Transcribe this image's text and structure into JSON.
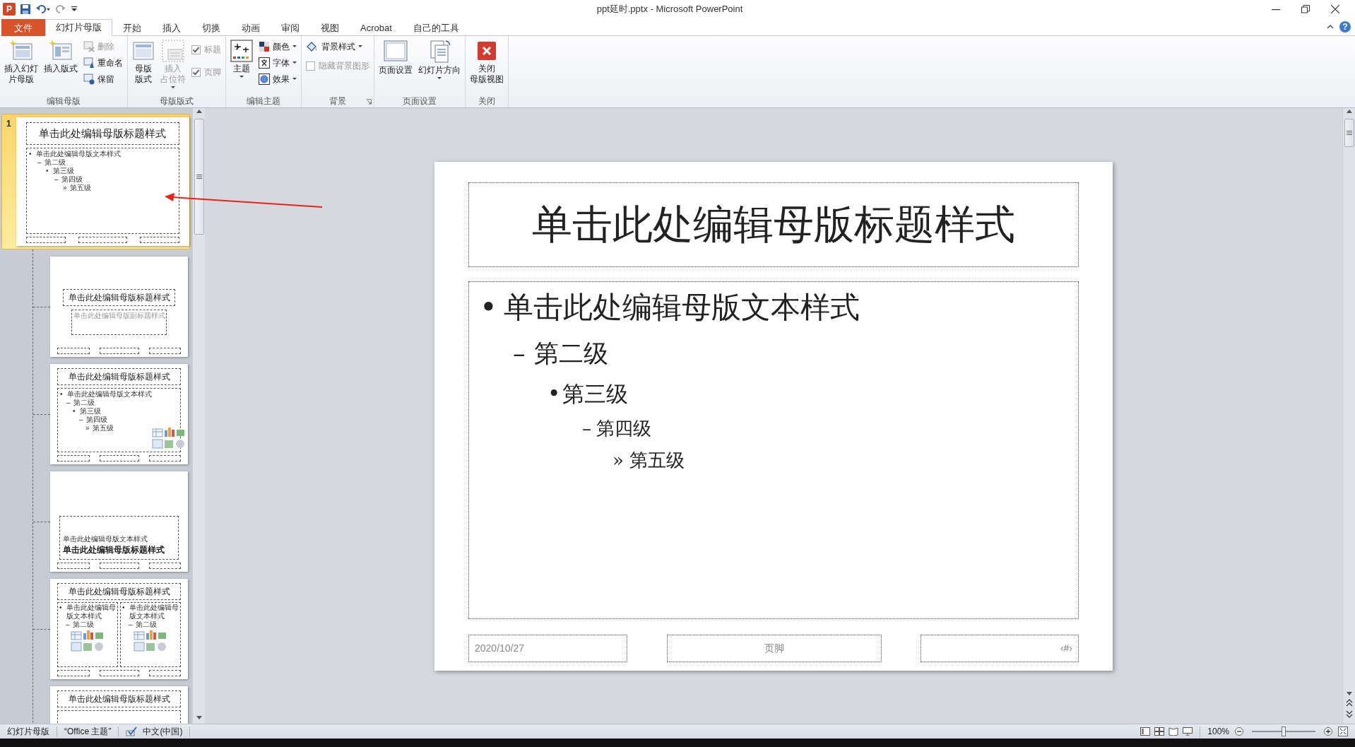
{
  "app": {
    "logo": "P",
    "title": "ppt延时.pptx  -  Microsoft PowerPoint",
    "help": "?"
  },
  "tabs": [
    {
      "label": "文件",
      "kind": "file",
      "selected": false
    },
    {
      "label": "幻灯片母版",
      "kind": "tab",
      "selected": true
    },
    {
      "label": "开始",
      "kind": "tab",
      "selected": false
    },
    {
      "label": "插入",
      "kind": "tab",
      "selected": false
    },
    {
      "label": "切换",
      "kind": "tab",
      "selected": false
    },
    {
      "label": "动画",
      "kind": "tab",
      "selected": false
    },
    {
      "label": "审阅",
      "kind": "tab",
      "selected": false
    },
    {
      "label": "视图",
      "kind": "tab",
      "selected": false
    },
    {
      "label": "Acrobat",
      "kind": "tab",
      "selected": false
    },
    {
      "label": "自己的工具",
      "kind": "tab",
      "selected": false
    }
  ],
  "ribbon": {
    "groups": [
      {
        "label": "编辑母版",
        "launcher": false,
        "controls": [
          {
            "kind": "large",
            "lines": [
              "插入幻灯",
              "片母版"
            ],
            "disabled": false,
            "dropdown": false
          },
          {
            "kind": "large",
            "lines": [
              "插入版式"
            ],
            "disabled": false,
            "dropdown": false
          },
          {
            "kind": "stack",
            "items": [
              {
                "kind": "small",
                "label": "删除",
                "disabled": true,
                "dropdown": false
              },
              {
                "kind": "small",
                "label": "重命名",
                "disabled": false,
                "dropdown": false
              },
              {
                "kind": "small",
                "label": "保留",
                "disabled": false,
                "dropdown": false
              }
            ]
          }
        ]
      },
      {
        "label": "母版版式",
        "launcher": false,
        "controls": [
          {
            "kind": "large",
            "lines": [
              "母版",
              "版式"
            ],
            "disabled": false,
            "dropdown": false
          },
          {
            "kind": "large",
            "lines": [
              "插入",
              "占位符"
            ],
            "disabled": true,
            "dropdown": true
          },
          {
            "kind": "stack",
            "items": [
              {
                "kind": "check",
                "label": "标题",
                "checked": true,
                "disabled": true
              },
              {
                "kind": "check",
                "label": "页脚",
                "checked": true,
                "disabled": true
              }
            ]
          }
        ]
      },
      {
        "label": "编辑主题",
        "launcher": false,
        "controls": [
          {
            "kind": "large",
            "lines": [
              "主题"
            ],
            "disabled": false,
            "dropdown": true
          },
          {
            "kind": "stack",
            "items": [
              {
                "kind": "small",
                "label": "颜色",
                "disabled": false,
                "dropdown": true
              },
              {
                "kind": "small",
                "label": "字体",
                "disabled": false,
                "dropdown": true
              },
              {
                "kind": "small",
                "label": "效果",
                "disabled": false,
                "dropdown": true
              }
            ]
          }
        ]
      },
      {
        "label": "背景",
        "launcher": true,
        "controls": [
          {
            "kind": "stack",
            "items": [
              {
                "kind": "small",
                "label": "背景样式",
                "disabled": false,
                "dropdown": true
              },
              {
                "kind": "check",
                "label": "隐藏背景图形",
                "checked": false,
                "disabled": true
              }
            ]
          }
        ]
      },
      {
        "label": "页面设置",
        "launcher": false,
        "controls": [
          {
            "kind": "large",
            "lines": [
              "页面设置"
            ],
            "disabled": false,
            "dropdown": false
          },
          {
            "kind": "large",
            "lines": [
              "幻灯片方向"
            ],
            "disabled": false,
            "dropdown": true
          }
        ]
      },
      {
        "label": "关闭",
        "launcher": false,
        "controls": [
          {
            "kind": "large",
            "lines": [
              "关闭",
              "母版视图"
            ],
            "disabled": false,
            "dropdown": false
          }
        ]
      }
    ]
  },
  "thumbnails": [
    {
      "number": "1",
      "selected": true,
      "kind": "title_body",
      "title": "单击此处编辑母版标题样式",
      "content_icons": false,
      "body": [
        {
          "bullet": "•",
          "text": "单击此处编辑母版文本样式",
          "children": [
            {
              "bullet": "–",
              "text": "第二级",
              "children": [
                {
                  "bullet": "•",
                  "text": "第三级",
                  "children": [
                    {
                      "bullet": "–",
                      "text": "第四级",
                      "children": [
                        {
                          "bullet": "»",
                          "text": "第五级"
                        }
                      ]
                    }
                  ]
                }
              ]
            }
          ]
        }
      ]
    },
    {
      "selected": false,
      "kind": "title_subtitle",
      "title": "单击此处编辑母版标题样式",
      "subtitle": "单击此处编辑母版副标题样式"
    },
    {
      "selected": false,
      "kind": "title_body",
      "title": "单击此处编辑母版标题样式",
      "content_icons": true,
      "body": [
        {
          "bullet": "•",
          "text": "单击此处编辑母版文本样式",
          "children": [
            {
              "bullet": "–",
              "text": "第二级",
              "children": [
                {
                  "bullet": "•",
                  "text": "第三级",
                  "children": [
                    {
                      "bullet": "–",
                      "text": "第四级",
                      "children": [
                        {
                          "bullet": "»",
                          "text": "第五级"
                        }
                      ]
                    }
                  ]
                }
              ]
            }
          ]
        }
      ]
    },
    {
      "selected": false,
      "kind": "section",
      "text": "单击此处编辑母版文本样式",
      "title": "单击此处编辑母版标题样式"
    },
    {
      "selected": false,
      "kind": "two_content",
      "title": "单击此处编辑母版标题样式",
      "columns": [
        {
          "content_icons": true,
          "body": [
            {
              "bullet": "•",
              "text": "单击此处编辑母版文本样式",
              "children": [
                {
                  "bullet": "–",
                  "text": "第二级"
                }
              ]
            }
          ]
        },
        {
          "content_icons": true,
          "body": [
            {
              "bullet": "•",
              "text": "单击此处编辑母版文本样式",
              "children": [
                {
                  "bullet": "–",
                  "text": "第二级"
                }
              ]
            }
          ]
        }
      ]
    },
    {
      "selected": false,
      "kind": "title_only",
      "title": "单击此处编辑母版标题样式"
    }
  ],
  "slide": {
    "title": "单击此处编辑母版标题样式",
    "body": [
      {
        "bullet": "•",
        "text": "单击此处编辑母版文本样式",
        "children": [
          {
            "bullet": "–",
            "text": "第二级",
            "children": [
              {
                "bullet": "•",
                "text": "第三级",
                "children": [
                  {
                    "bullet": "–",
                    "text": "第四级",
                    "children": [
                      {
                        "bullet": "»",
                        "text": "第五级"
                      }
                    ]
                  }
                ]
              }
            ]
          }
        ]
      }
    ],
    "date": "2020/10/27",
    "footer": "页脚",
    "number": "‹#›"
  },
  "status_bar": {
    "items": [
      "幻灯片母版",
      "“Office 主题”",
      "中文(中国)"
    ],
    "zoom": "100%",
    "zoom_slider": {
      "level": 0.5
    }
  }
}
